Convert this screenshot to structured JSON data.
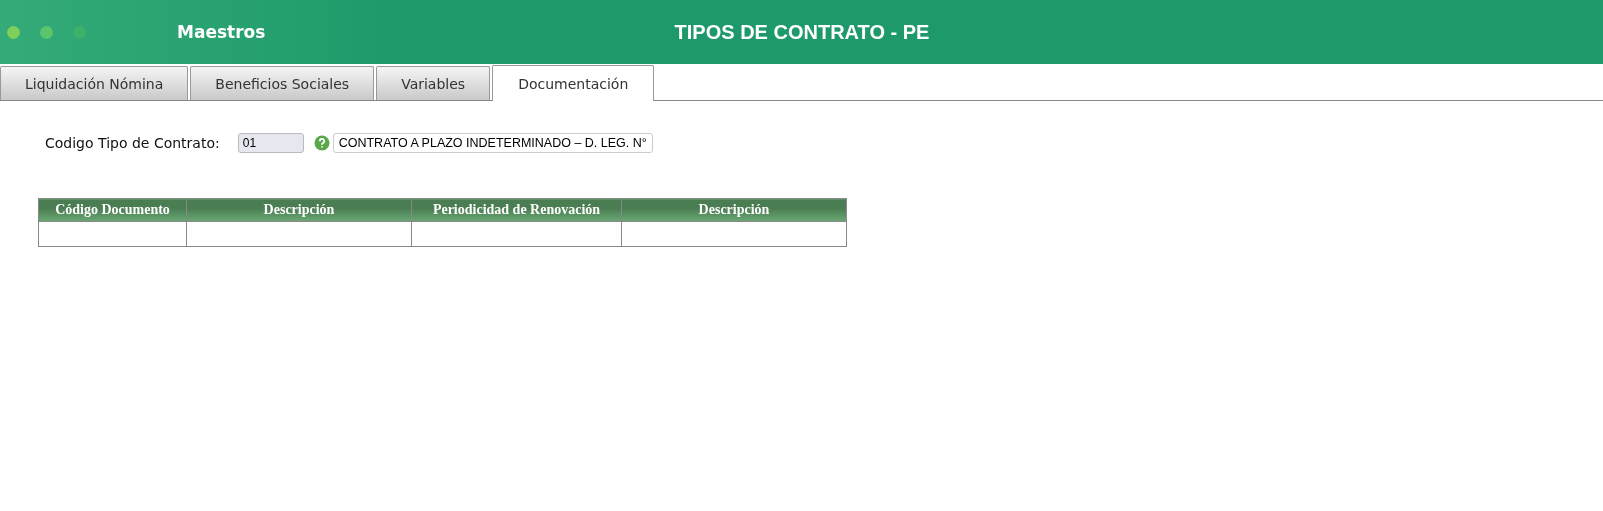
{
  "header": {
    "section": "Maestros",
    "title": "TIPOS DE CONTRATO - PE"
  },
  "tabs": [
    {
      "label": "Liquidación Nómina",
      "selected": false
    },
    {
      "label": "Beneficios Sociales",
      "selected": false
    },
    {
      "label": "Variables",
      "selected": false
    },
    {
      "label": "Documentación",
      "selected": true
    }
  ],
  "form": {
    "label": "Codigo Tipo de Contrato:",
    "code": "01",
    "description": "CONTRATO A PLAZO INDETERMINADO – D. LEG. N°"
  },
  "table": {
    "columns": [
      "Código Documento",
      "Descripción",
      "Periodicidad de Renovación",
      "Descripción"
    ]
  }
}
